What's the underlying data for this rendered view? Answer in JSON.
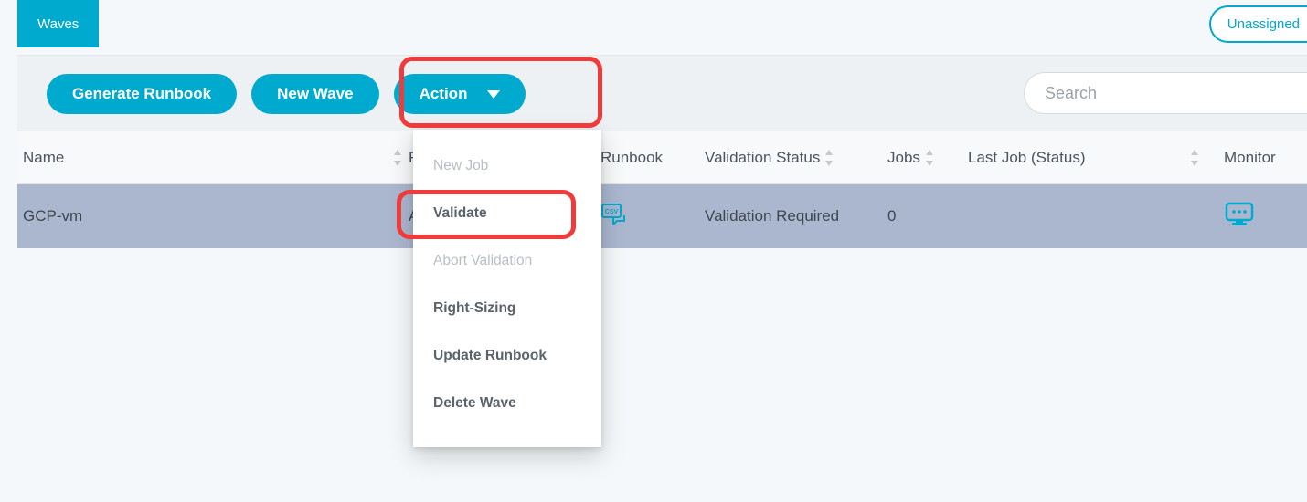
{
  "header": {
    "tab": "Waves",
    "unassigned": "Unassigned"
  },
  "toolbar": {
    "generate": "Generate Runbook",
    "new_wave": "New Wave",
    "action": "Action",
    "search_placeholder": "Search"
  },
  "action_menu": {
    "items": [
      {
        "label": "New Job",
        "disabled": true
      },
      {
        "label": "Validate",
        "disabled": false
      },
      {
        "label": "Abort Validation",
        "disabled": true
      },
      {
        "label": "Right-Sizing",
        "disabled": false
      },
      {
        "label": "Update Runbook",
        "disabled": false
      },
      {
        "label": "Delete Wave",
        "disabled": false
      }
    ]
  },
  "table": {
    "columns": {
      "name": "Name",
      "hidden_initial": "R",
      "runbook": "Runbook",
      "validation": "Validation Status",
      "jobs": "Jobs",
      "last_job": "Last Job (Status)",
      "monitor": "Monitor"
    },
    "rows": [
      {
        "name": "GCP-vm",
        "hidden_val": "A",
        "validation": "Validation Required",
        "jobs": "0",
        "last_job": ""
      }
    ]
  }
}
